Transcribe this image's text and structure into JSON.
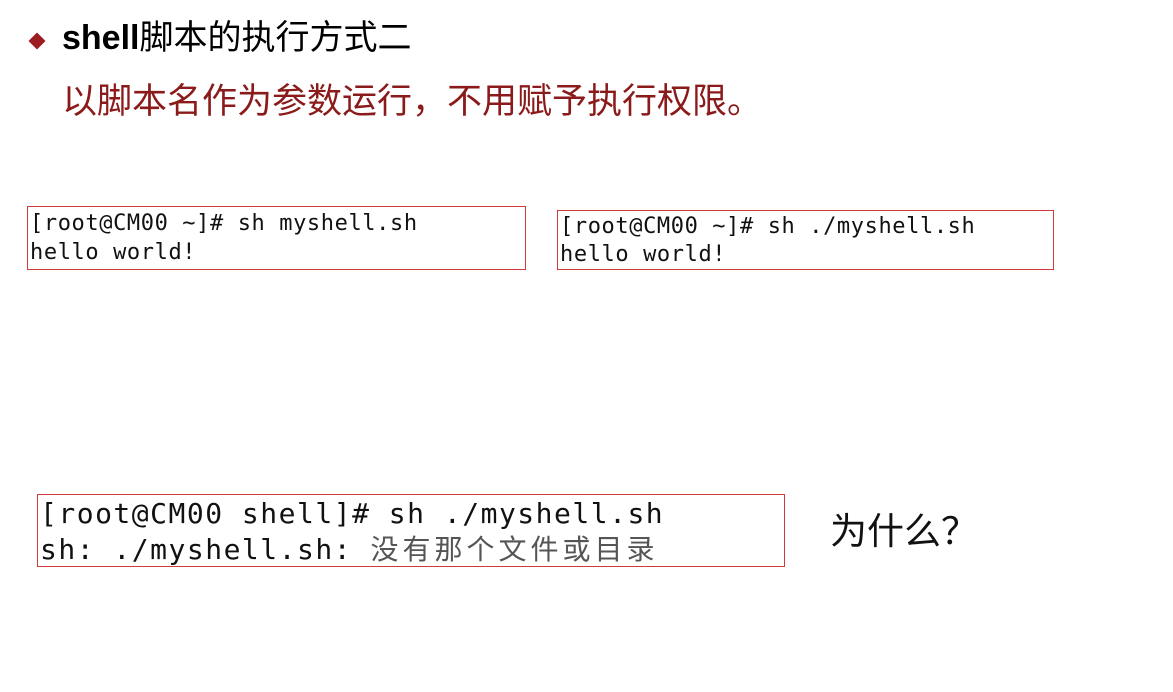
{
  "heading": {
    "latin": "shell",
    "cjk": "脚本的执行方式二"
  },
  "subheading": "以脚本名作为参数运行，不用赋予执行权限。",
  "terminals": [
    {
      "prompt": "[root@CM00 ~]#",
      "command": " sh myshell.sh",
      "output": "hello world!"
    },
    {
      "prompt": "[root@CM00 ~]#",
      "command": " sh ./myshell.sh",
      "output": "hello world!"
    },
    {
      "prompt": "[root@CM00 shell]#",
      "command": " sh ./myshell.sh",
      "output_prefix": "sh: ./myshell.sh: ",
      "output_cjk": "没有那个文件或目录"
    }
  ],
  "question": "为什么？",
  "colors": {
    "bullet": "#9c1c24",
    "subheading": "#8b1a1a",
    "terminal_border": "#d23a3a"
  }
}
